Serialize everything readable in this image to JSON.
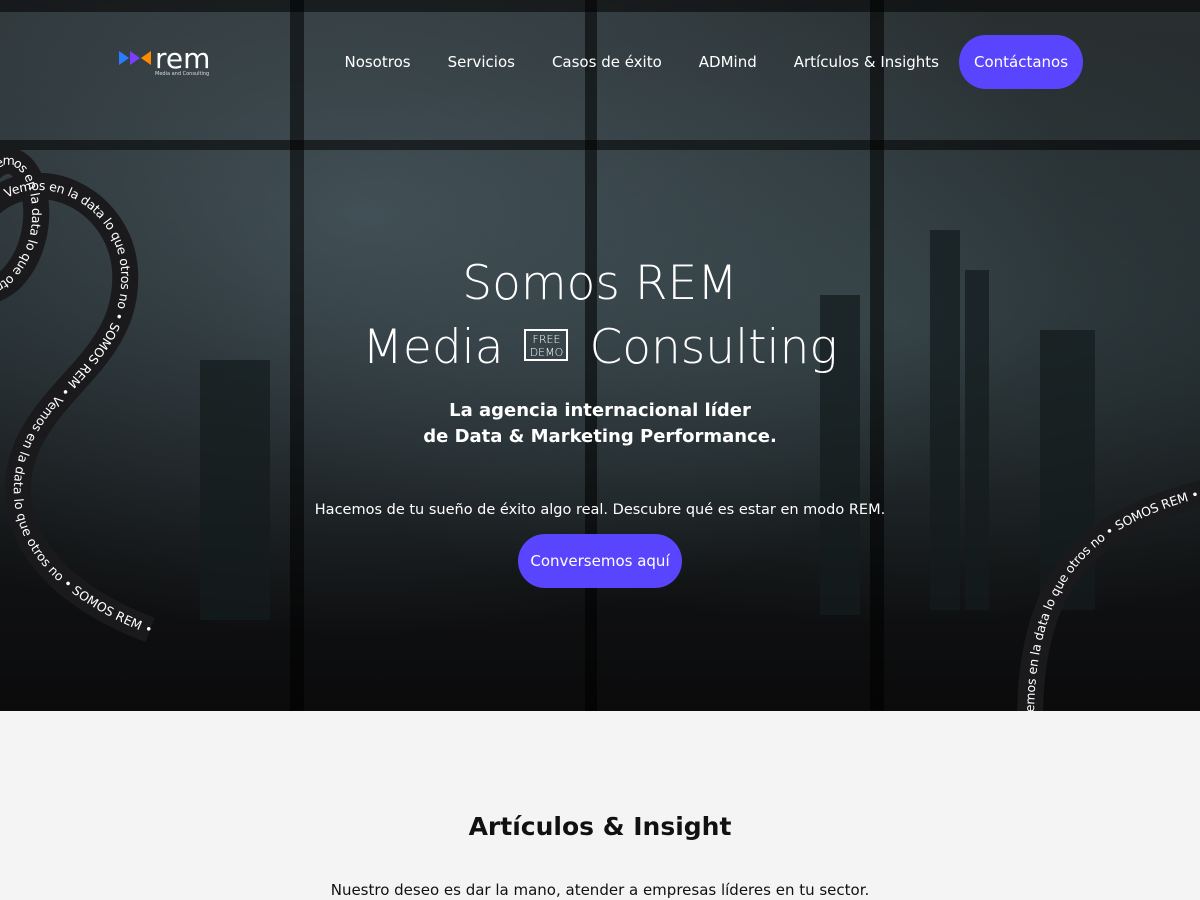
{
  "brand": {
    "name": "rem",
    "tagline": "Media and Consulting",
    "colors": {
      "blue": "#2b7bff",
      "purple": "#7b3dff",
      "orange": "#ff8a00",
      "accent": "#5a45ff"
    }
  },
  "nav": {
    "items": [
      {
        "label": "Nosotros"
      },
      {
        "label": "Servicios"
      },
      {
        "label": "Casos de éxito"
      },
      {
        "label": "ADMind"
      },
      {
        "label": "Artículos & Insights"
      }
    ],
    "cta": "Contáctanos"
  },
  "hero": {
    "title_line1": "Somos REM",
    "title_line2_left": "Media",
    "title_line2_badge_top": "FREE",
    "title_line2_badge_bottom": "DEMO",
    "title_line2_right": "Consulting",
    "subtitle_line1": "La agencia internacional líder",
    "subtitle_line2": "de Data & Marketing Performance.",
    "description": "Hacemos de tu sueño de éxito algo real. Descubre qué es estar en modo REM.",
    "cta": "Conversemos aquí"
  },
  "ribbon": {
    "text": "Vemos en la data lo que otros no • SOMOS REM • Vemos en la data lo que otros no • SOMOS REM • Vemos en la data lo que otros no • SOMOS REM • "
  },
  "section": {
    "title": "Artículos & Insight",
    "text": "Nuestro deseo es dar la mano, atender a empresas líderes en tu sector."
  }
}
